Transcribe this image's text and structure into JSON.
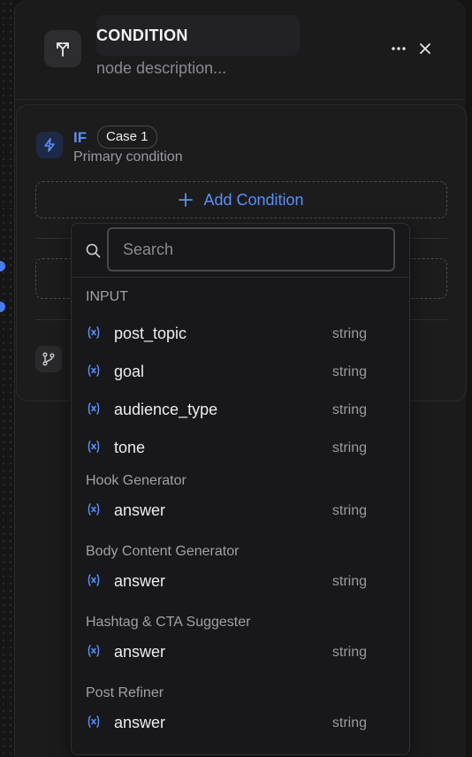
{
  "header": {
    "title": "CONDITION",
    "description_placeholder": "node description...",
    "more_icon": "more-horizontal-icon",
    "close_icon": "close-icon"
  },
  "case": {
    "if_label": "IF",
    "case_badge": "Case 1",
    "subtitle": "Primary condition",
    "add_condition_label": "Add Condition"
  },
  "dropdown": {
    "search_placeholder": "Search",
    "groups": [
      {
        "title": "INPUT",
        "items": [
          {
            "name": "post_topic",
            "type": "string"
          },
          {
            "name": "goal",
            "type": "string"
          },
          {
            "name": "audience_type",
            "type": "string"
          },
          {
            "name": "tone",
            "type": "string"
          }
        ]
      },
      {
        "title": "Hook Generator",
        "items": [
          {
            "name": "answer",
            "type": "string"
          }
        ]
      },
      {
        "title": "Body Content Generator",
        "items": [
          {
            "name": "answer",
            "type": "string"
          }
        ]
      },
      {
        "title": "Hashtag & CTA Suggester",
        "items": [
          {
            "name": "answer",
            "type": "string"
          }
        ]
      },
      {
        "title": "Post Refiner",
        "items": [
          {
            "name": "answer",
            "type": "string"
          }
        ]
      }
    ]
  },
  "colors": {
    "accent": "#5b8ff9",
    "background": "#141414",
    "panel": "#1b1b1c"
  }
}
